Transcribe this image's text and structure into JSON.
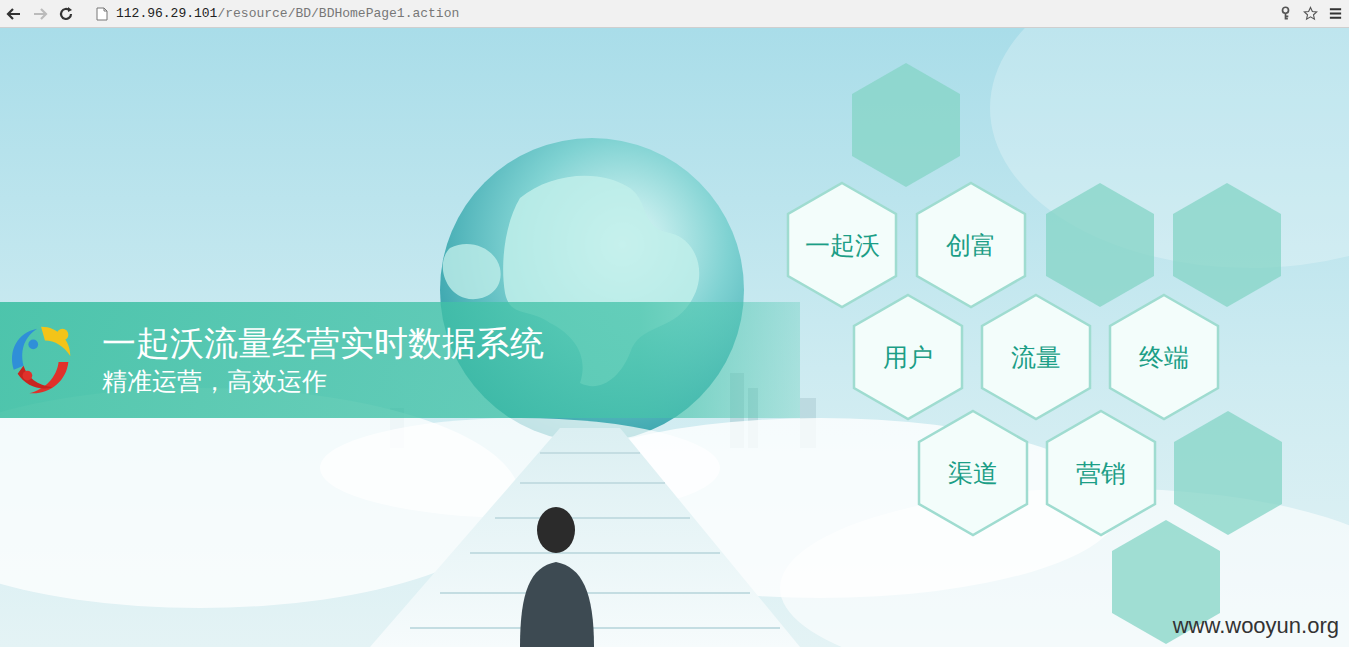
{
  "browser": {
    "back_enabled": true,
    "forward_enabled": false,
    "url": {
      "host": "112.96.29.101",
      "path": "/resource/BD/BDHomePage1.action"
    }
  },
  "banner": {
    "title": "一起沃流量经营实时数据系统",
    "subtitle": "精准运营，高效运作"
  },
  "tiles": [
    {
      "kind": "empty"
    },
    {
      "kind": "label",
      "label": "一起沃"
    },
    {
      "kind": "label",
      "label": "创富"
    },
    {
      "kind": "empty"
    },
    {
      "kind": "empty"
    },
    {
      "kind": "label",
      "label": "用户"
    },
    {
      "kind": "label",
      "label": "流量"
    },
    {
      "kind": "label",
      "label": "终端"
    },
    {
      "kind": "label",
      "label": "渠道"
    },
    {
      "kind": "label",
      "label": "营销"
    },
    {
      "kind": "empty"
    },
    {
      "kind": "empty"
    }
  ],
  "watermark": "www.wooyun.org"
}
